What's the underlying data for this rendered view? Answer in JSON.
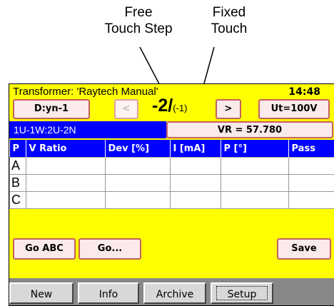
{
  "callouts": {
    "free_line1": "Free",
    "free_line2": "Touch Step",
    "fixed_line1": "Fixed",
    "fixed_line2": "Touch"
  },
  "header": {
    "title": "Transformer: 'Raytech Manual'",
    "time": "14:48"
  },
  "controls": {
    "vector_group": "D:yn-1",
    "prev": "<",
    "step_free": "-2/",
    "step_fixed": "(-1)",
    "next": ">",
    "test_voltage": "Ut=100V"
  },
  "winding": "1U-1W:2U-2N",
  "vr_value": "VR = 57.780",
  "table": {
    "headers": [
      "P",
      "V Ratio",
      "Dev [%]",
      "I [mA]",
      "P [°]",
      "Pass"
    ],
    "rows": [
      [
        "A",
        "",
        "",
        "",
        "",
        ""
      ],
      [
        "B",
        "",
        "",
        "",
        "",
        ""
      ],
      [
        "C",
        "",
        "",
        "",
        "",
        ""
      ]
    ]
  },
  "actions": {
    "go_abc": "Go ABC",
    "go": "Go...",
    "save": "Save"
  },
  "menu": {
    "new": "New",
    "info": "Info",
    "archive": "Archive",
    "setup": "Setup"
  },
  "colors": {
    "screen_background": "#ffff00",
    "header_blue": "#0000ff",
    "button_border": "#c46060"
  }
}
